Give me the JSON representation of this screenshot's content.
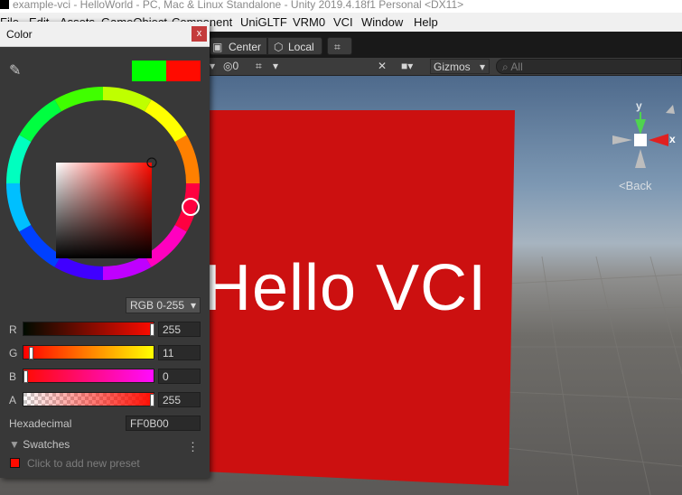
{
  "window_title": "example-vci - HelloWorld - PC, Mac & Linux Standalone - Unity 2019.4.18f1 Personal <DX11>",
  "menu": [
    "File",
    "Edit",
    "Assets",
    "GameObject",
    "Component",
    "UniGLTF",
    "VRM0",
    "VCI",
    "Window",
    "Help"
  ],
  "toolbar": {
    "center_label": "Center",
    "local_label": "Local",
    "layers_icon": "grid-snap-icon"
  },
  "scene_toolbar": {
    "hidden_count": "0",
    "gizmos_label": "Gizmos",
    "search_placeholder": "All"
  },
  "gizmo": {
    "y_label": "y",
    "x_label": "x",
    "back_label": "Back"
  },
  "scene": {
    "text": "Hello VCI",
    "cube_color": "#cc1010"
  },
  "color_picker": {
    "title": "Color",
    "close_label": "x",
    "preview_new": "#00ff00",
    "preview_current": "#ff0b00",
    "mode_label": "RGB 0-255",
    "channels": [
      {
        "label": "R",
        "value": "255",
        "fraction": 1.0
      },
      {
        "label": "G",
        "value": "11",
        "fraction": 0.043
      },
      {
        "label": "B",
        "value": "0",
        "fraction": 0.0
      },
      {
        "label": "A",
        "value": "255",
        "fraction": 1.0
      }
    ],
    "hex_label": "Hexadecimal",
    "hex_value": "FF0B00",
    "swatches_label": "Swatches",
    "add_preset_label": "Click to add new preset",
    "swatch_color": "#ff0b00"
  }
}
